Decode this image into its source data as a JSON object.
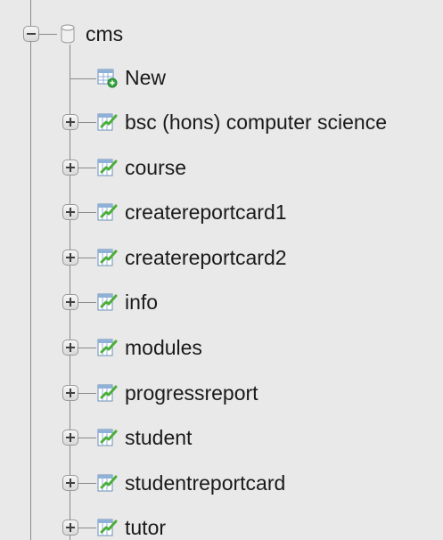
{
  "database": {
    "name": "cms",
    "icon": "database-icon",
    "expanded": true
  },
  "new_item": {
    "label": "New",
    "icon": "new-table-icon"
  },
  "views": [
    {
      "label": "bsc (hons) computer science",
      "icon": "view-icon"
    },
    {
      "label": "course",
      "icon": "view-icon"
    },
    {
      "label": "createreportcard1",
      "icon": "view-icon"
    },
    {
      "label": "createreportcard2",
      "icon": "view-icon"
    },
    {
      "label": "info",
      "icon": "view-icon"
    },
    {
      "label": "modules",
      "icon": "view-icon"
    },
    {
      "label": "progressreport",
      "icon": "view-icon"
    },
    {
      "label": "student",
      "icon": "view-icon"
    },
    {
      "label": "studentreportcard",
      "icon": "view-icon"
    },
    {
      "label": "tutor",
      "icon": "view-icon"
    }
  ],
  "colors": {
    "background": "#e9e9e9",
    "tree_line": "#8a8a8a",
    "text": "#1a1a1a"
  }
}
